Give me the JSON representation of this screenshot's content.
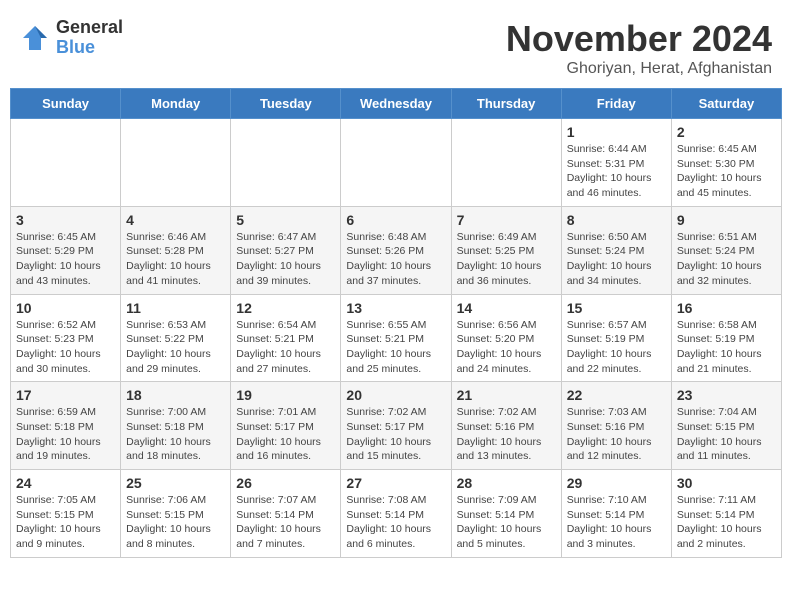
{
  "logo": {
    "general": "General",
    "blue": "Blue"
  },
  "header": {
    "month": "November 2024",
    "location": "Ghoriyan, Herat, Afghanistan"
  },
  "weekdays": [
    "Sunday",
    "Monday",
    "Tuesday",
    "Wednesday",
    "Thursday",
    "Friday",
    "Saturday"
  ],
  "weeks": [
    [
      {
        "day": "",
        "info": ""
      },
      {
        "day": "",
        "info": ""
      },
      {
        "day": "",
        "info": ""
      },
      {
        "day": "",
        "info": ""
      },
      {
        "day": "",
        "info": ""
      },
      {
        "day": "1",
        "info": "Sunrise: 6:44 AM\nSunset: 5:31 PM\nDaylight: 10 hours and 46 minutes."
      },
      {
        "day": "2",
        "info": "Sunrise: 6:45 AM\nSunset: 5:30 PM\nDaylight: 10 hours and 45 minutes."
      }
    ],
    [
      {
        "day": "3",
        "info": "Sunrise: 6:45 AM\nSunset: 5:29 PM\nDaylight: 10 hours and 43 minutes."
      },
      {
        "day": "4",
        "info": "Sunrise: 6:46 AM\nSunset: 5:28 PM\nDaylight: 10 hours and 41 minutes."
      },
      {
        "day": "5",
        "info": "Sunrise: 6:47 AM\nSunset: 5:27 PM\nDaylight: 10 hours and 39 minutes."
      },
      {
        "day": "6",
        "info": "Sunrise: 6:48 AM\nSunset: 5:26 PM\nDaylight: 10 hours and 37 minutes."
      },
      {
        "day": "7",
        "info": "Sunrise: 6:49 AM\nSunset: 5:25 PM\nDaylight: 10 hours and 36 minutes."
      },
      {
        "day": "8",
        "info": "Sunrise: 6:50 AM\nSunset: 5:24 PM\nDaylight: 10 hours and 34 minutes."
      },
      {
        "day": "9",
        "info": "Sunrise: 6:51 AM\nSunset: 5:24 PM\nDaylight: 10 hours and 32 minutes."
      }
    ],
    [
      {
        "day": "10",
        "info": "Sunrise: 6:52 AM\nSunset: 5:23 PM\nDaylight: 10 hours and 30 minutes."
      },
      {
        "day": "11",
        "info": "Sunrise: 6:53 AM\nSunset: 5:22 PM\nDaylight: 10 hours and 29 minutes."
      },
      {
        "day": "12",
        "info": "Sunrise: 6:54 AM\nSunset: 5:21 PM\nDaylight: 10 hours and 27 minutes."
      },
      {
        "day": "13",
        "info": "Sunrise: 6:55 AM\nSunset: 5:21 PM\nDaylight: 10 hours and 25 minutes."
      },
      {
        "day": "14",
        "info": "Sunrise: 6:56 AM\nSunset: 5:20 PM\nDaylight: 10 hours and 24 minutes."
      },
      {
        "day": "15",
        "info": "Sunrise: 6:57 AM\nSunset: 5:19 PM\nDaylight: 10 hours and 22 minutes."
      },
      {
        "day": "16",
        "info": "Sunrise: 6:58 AM\nSunset: 5:19 PM\nDaylight: 10 hours and 21 minutes."
      }
    ],
    [
      {
        "day": "17",
        "info": "Sunrise: 6:59 AM\nSunset: 5:18 PM\nDaylight: 10 hours and 19 minutes."
      },
      {
        "day": "18",
        "info": "Sunrise: 7:00 AM\nSunset: 5:18 PM\nDaylight: 10 hours and 18 minutes."
      },
      {
        "day": "19",
        "info": "Sunrise: 7:01 AM\nSunset: 5:17 PM\nDaylight: 10 hours and 16 minutes."
      },
      {
        "day": "20",
        "info": "Sunrise: 7:02 AM\nSunset: 5:17 PM\nDaylight: 10 hours and 15 minutes."
      },
      {
        "day": "21",
        "info": "Sunrise: 7:02 AM\nSunset: 5:16 PM\nDaylight: 10 hours and 13 minutes."
      },
      {
        "day": "22",
        "info": "Sunrise: 7:03 AM\nSunset: 5:16 PM\nDaylight: 10 hours and 12 minutes."
      },
      {
        "day": "23",
        "info": "Sunrise: 7:04 AM\nSunset: 5:15 PM\nDaylight: 10 hours and 11 minutes."
      }
    ],
    [
      {
        "day": "24",
        "info": "Sunrise: 7:05 AM\nSunset: 5:15 PM\nDaylight: 10 hours and 9 minutes."
      },
      {
        "day": "25",
        "info": "Sunrise: 7:06 AM\nSunset: 5:15 PM\nDaylight: 10 hours and 8 minutes."
      },
      {
        "day": "26",
        "info": "Sunrise: 7:07 AM\nSunset: 5:14 PM\nDaylight: 10 hours and 7 minutes."
      },
      {
        "day": "27",
        "info": "Sunrise: 7:08 AM\nSunset: 5:14 PM\nDaylight: 10 hours and 6 minutes."
      },
      {
        "day": "28",
        "info": "Sunrise: 7:09 AM\nSunset: 5:14 PM\nDaylight: 10 hours and 5 minutes."
      },
      {
        "day": "29",
        "info": "Sunrise: 7:10 AM\nSunset: 5:14 PM\nDaylight: 10 hours and 3 minutes."
      },
      {
        "day": "30",
        "info": "Sunrise: 7:11 AM\nSunset: 5:14 PM\nDaylight: 10 hours and 2 minutes."
      }
    ]
  ]
}
